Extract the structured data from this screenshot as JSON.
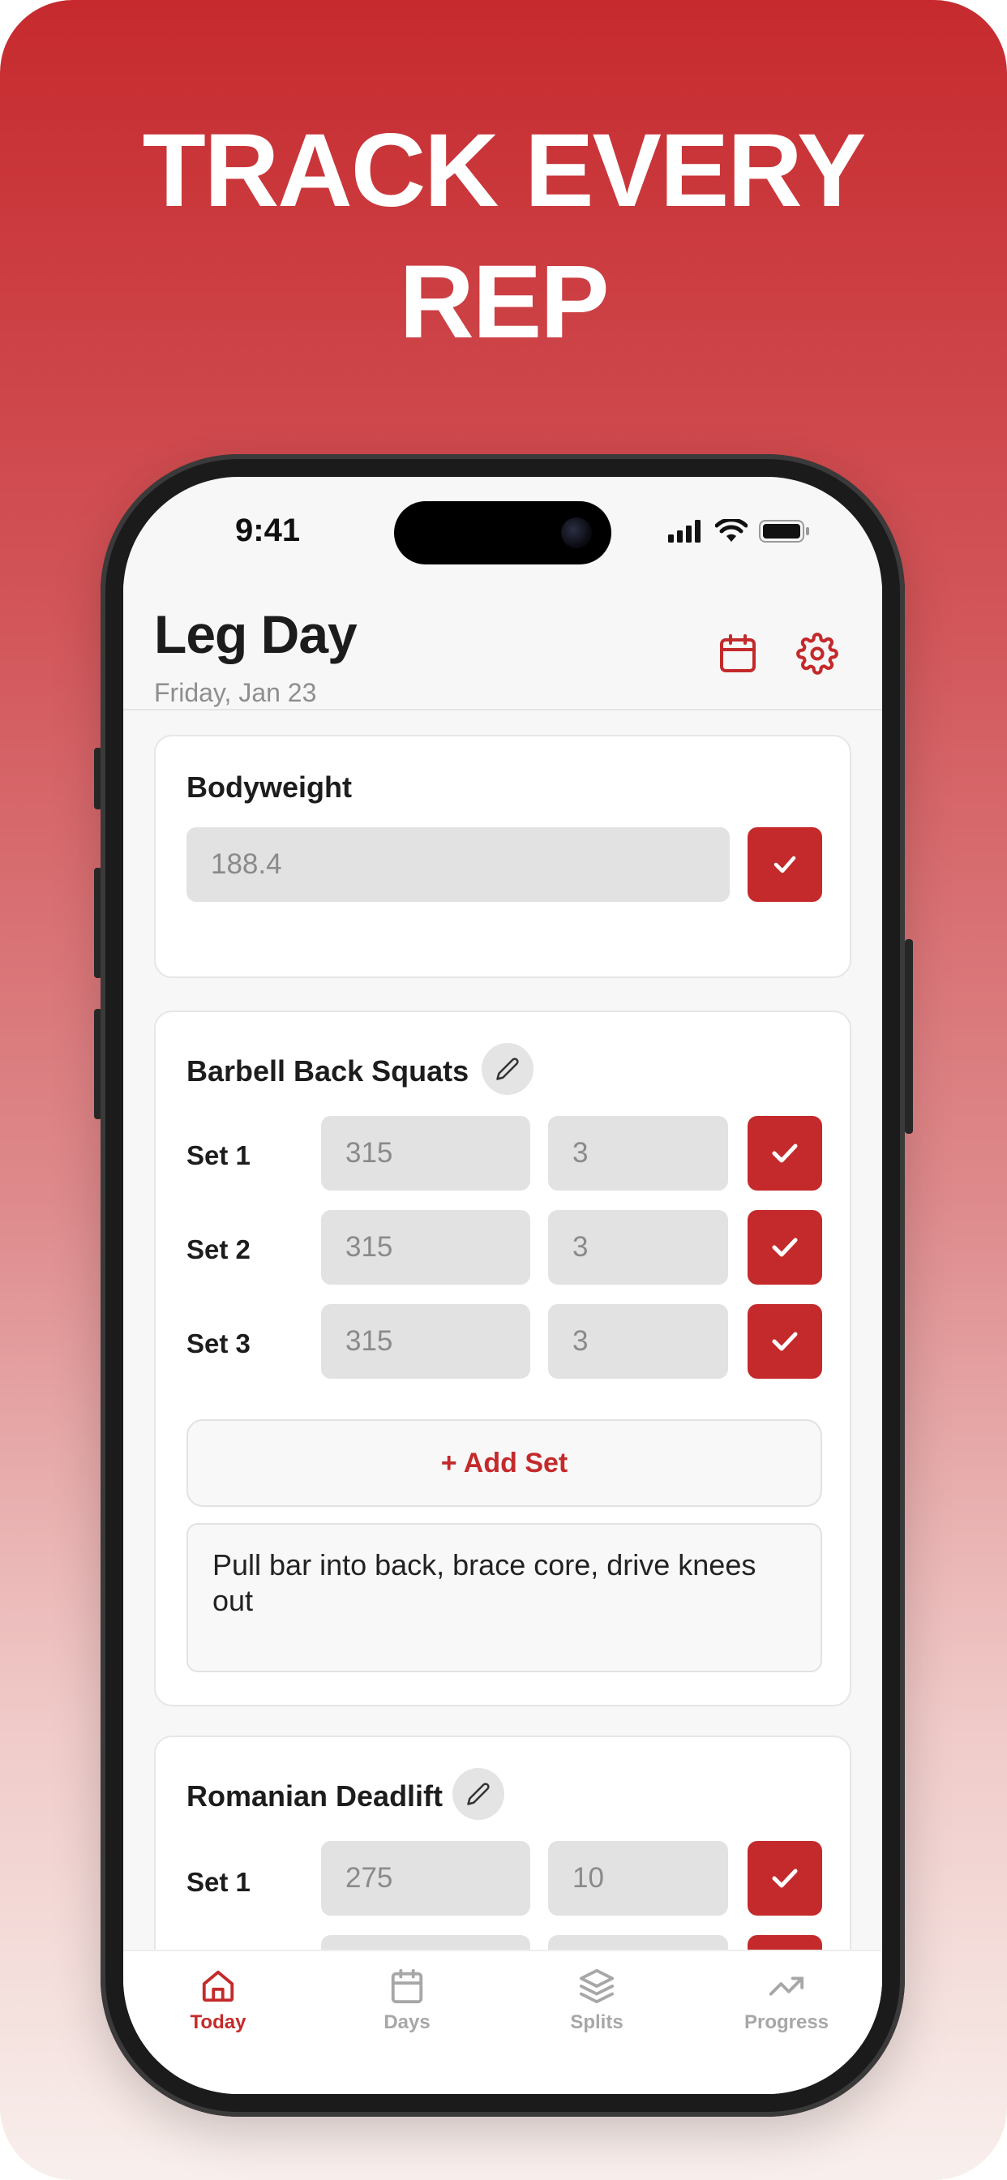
{
  "promo": {
    "headline_line1": "TRACK EVERY",
    "headline_line2": "REP"
  },
  "status_bar": {
    "time": "9:41",
    "icons": [
      "cellular-signal-icon",
      "wifi-icon",
      "battery-icon"
    ]
  },
  "header": {
    "title": "Leg Day",
    "date": "Friday, Jan 23",
    "icons": [
      "calendar-icon",
      "gear-icon"
    ]
  },
  "bodyweight": {
    "title": "Bodyweight",
    "value": "188.4"
  },
  "exercises": [
    {
      "name": "Barbell Back Squats",
      "sets": [
        {
          "label": "Set 1",
          "weight": "315",
          "reps": "3"
        },
        {
          "label": "Set 2",
          "weight": "315",
          "reps": "3"
        },
        {
          "label": "Set 3",
          "weight": "315",
          "reps": "3"
        }
      ],
      "add_set_label": "+ Add Set",
      "notes": "Pull bar into back, brace core, drive knees out"
    },
    {
      "name": "Romanian Deadlift",
      "sets": [
        {
          "label": "Set 1",
          "weight": "275",
          "reps": "10"
        }
      ]
    }
  ],
  "tabs": [
    {
      "label": "Today",
      "icon": "home-icon",
      "active": true
    },
    {
      "label": "Days",
      "icon": "calendar-icon",
      "active": false
    },
    {
      "label": "Splits",
      "icon": "layers-icon",
      "active": false
    },
    {
      "label": "Progress",
      "icon": "trending-up-icon",
      "active": false
    }
  ],
  "colors": {
    "accent": "#c42a2b",
    "gradient_top": "#c62a2e",
    "gradient_bottom": "#f8efec"
  }
}
